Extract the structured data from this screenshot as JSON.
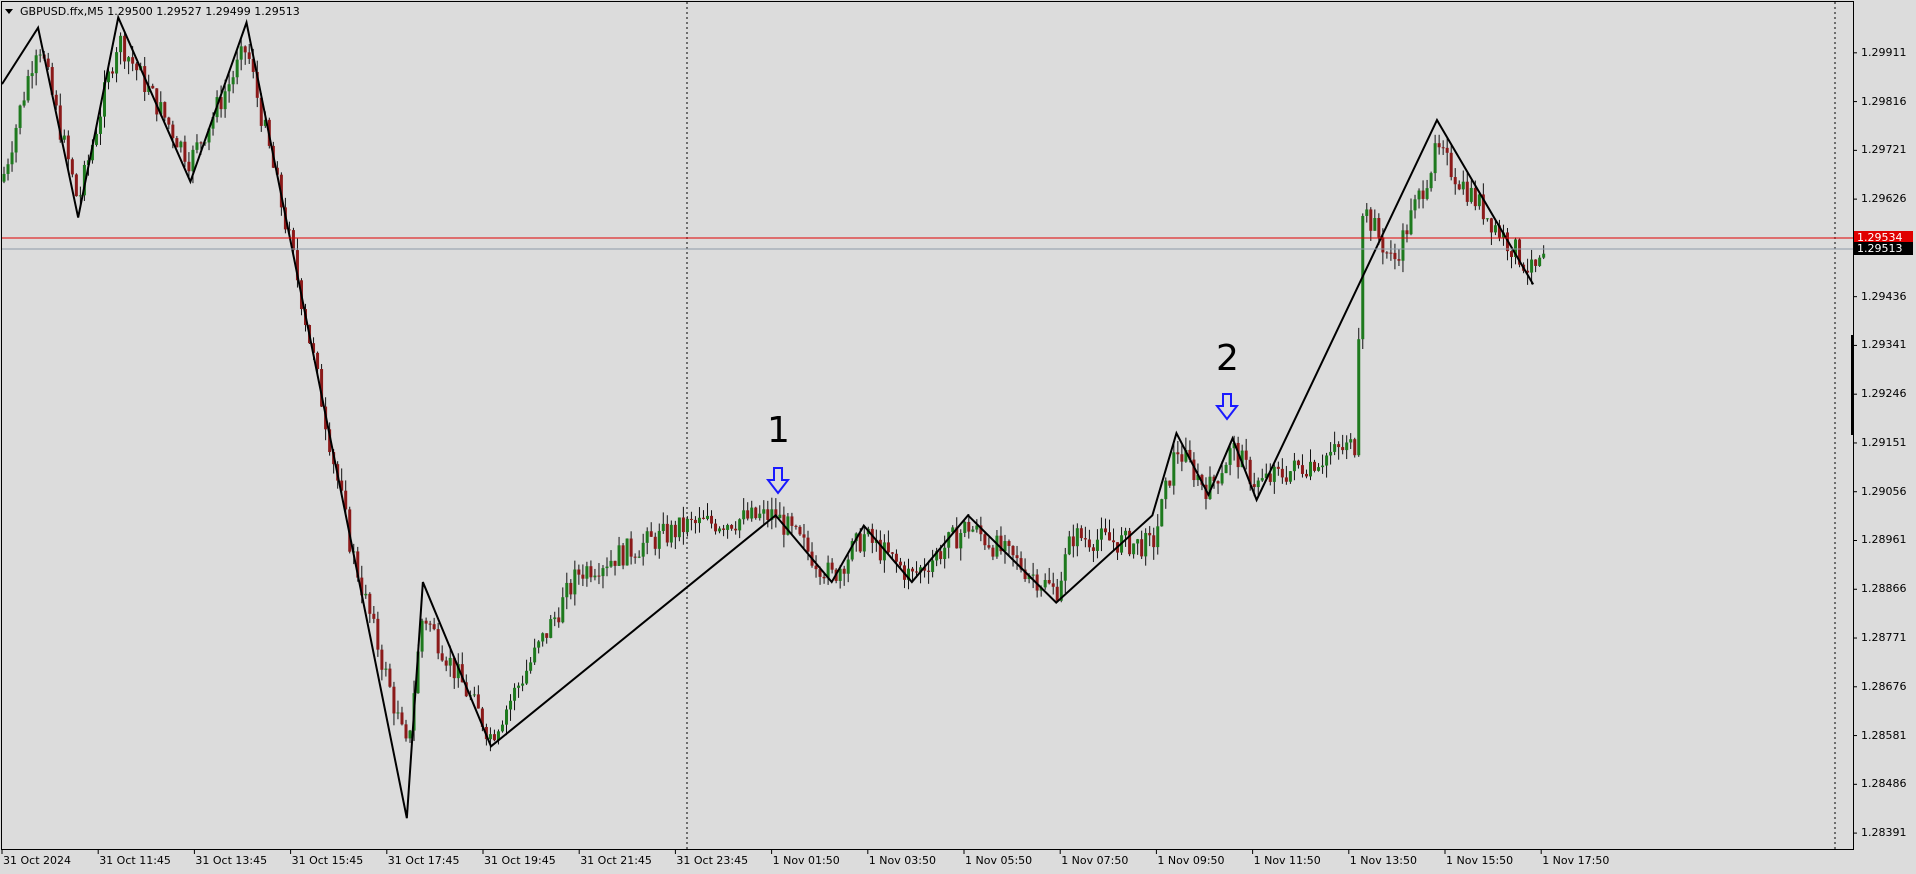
{
  "header": {
    "symbol_info": "GBPUSD.ffx,M5  1.29500 1.29527 1.29499 1.29513"
  },
  "colors": {
    "background": "#dcdcdc",
    "bull_candle": "#1e7a1e",
    "bear_candle": "#8b1a1a",
    "zigzag": "#000000",
    "bid_line": "#e00000",
    "ask_line": "#8e9aa8",
    "arrow": "#1a1aff"
  },
  "price_axis": {
    "ticks": [
      "1.29911",
      "1.29816",
      "1.29721",
      "1.29626",
      "1.29436",
      "1.29341",
      "1.29246",
      "1.29151",
      "1.29056",
      "1.28961",
      "1.28866",
      "1.28771",
      "1.28676",
      "1.28581",
      "1.28486",
      "1.28391"
    ],
    "bid_label": "1.29534",
    "ask_label": "1.29513"
  },
  "time_axis": {
    "labels": [
      "31 Oct 2024",
      "31 Oct 11:45",
      "31 Oct 13:45",
      "31 Oct 15:45",
      "31 Oct 17:45",
      "31 Oct 19:45",
      "31 Oct 21:45",
      "31 Oct 23:45",
      "1 Nov 01:50",
      "1 Nov 03:50",
      "1 Nov 05:50",
      "1 Nov 07:50",
      "1 Nov 09:50",
      "1 Nov 11:50",
      "1 Nov 13:50",
      "1 Nov 15:50",
      "1 Nov 17:50"
    ]
  },
  "annotations": [
    {
      "label": "1",
      "icon": "down-arrow-icon"
    },
    {
      "label": "2",
      "icon": "down-arrow-icon"
    }
  ],
  "chart_data": {
    "type": "candlestick",
    "timeframe": "M5",
    "ylim": [
      1.2836,
      1.3001
    ],
    "zigzag_points": [
      {
        "x": "31 Oct 2024",
        "y": 1.2985
      },
      {
        "x": "31 Oct 10:30",
        "y": 1.2996
      },
      {
        "x": "31 Oct 11:20",
        "y": 1.2959
      },
      {
        "x": "31 Oct 12:10",
        "y": 1.2998
      },
      {
        "x": "31 Oct 13:40",
        "y": 1.2966
      },
      {
        "x": "31 Oct 14:50",
        "y": 1.2997
      },
      {
        "x": "31 Oct 18:10",
        "y": 1.2842
      },
      {
        "x": "31 Oct 18:30",
        "y": 1.2888
      },
      {
        "x": "31 Oct 19:55",
        "y": 1.2856
      },
      {
        "x": "1 Nov 01:50",
        "y": 1.2901
      },
      {
        "x": "1 Nov 03:00",
        "y": 1.2888
      },
      {
        "x": "1 Nov 03:40",
        "y": 1.2899
      },
      {
        "x": "1 Nov 04:40",
        "y": 1.2888
      },
      {
        "x": "1 Nov 05:50",
        "y": 1.2901
      },
      {
        "x": "1 Nov 07:40",
        "y": 1.2884
      },
      {
        "x": "1 Nov 09:40",
        "y": 1.2901
      },
      {
        "x": "1 Nov 10:10",
        "y": 1.2917
      },
      {
        "x": "1 Nov 10:50",
        "y": 1.2905
      },
      {
        "x": "1 Nov 11:20",
        "y": 1.2916
      },
      {
        "x": "1 Nov 11:50",
        "y": 1.2904
      },
      {
        "x": "1 Nov 15:35",
        "y": 1.2978
      },
      {
        "x": "1 Nov 17:35",
        "y": 1.2946
      }
    ],
    "close_path": [
      {
        "x": "31 Oct 2024",
        "y": 1.2966
      },
      {
        "x": "31 Oct 10:30",
        "y": 1.2994
      },
      {
        "x": "31 Oct 11:20",
        "y": 1.2962
      },
      {
        "x": "31 Oct 12:10",
        "y": 1.2994
      },
      {
        "x": "31 Oct 13:40",
        "y": 1.297
      },
      {
        "x": "31 Oct 14:50",
        "y": 1.2992
      },
      {
        "x": "31 Oct 15:50",
        "y": 1.295
      },
      {
        "x": "31 Oct 17:00",
        "y": 1.2895
      },
      {
        "x": "31 Oct 18:10",
        "y": 1.2855
      },
      {
        "x": "31 Oct 18:30",
        "y": 1.2882
      },
      {
        "x": "31 Oct 19:55",
        "y": 1.2858
      },
      {
        "x": "31 Oct 21:45",
        "y": 1.289
      },
      {
        "x": "1 Nov 00:00",
        "y": 1.2899
      },
      {
        "x": "1 Nov 01:50",
        "y": 1.2901
      },
      {
        "x": "1 Nov 03:00",
        "y": 1.2889
      },
      {
        "x": "1 Nov 03:40",
        "y": 1.2897
      },
      {
        "x": "1 Nov 04:40",
        "y": 1.2889
      },
      {
        "x": "1 Nov 05:50",
        "y": 1.2899
      },
      {
        "x": "1 Nov 07:40",
        "y": 1.2886
      },
      {
        "x": "1 Nov 08:00",
        "y": 1.2897
      },
      {
        "x": "1 Nov 09:40",
        "y": 1.2895
      },
      {
        "x": "1 Nov 10:10",
        "y": 1.2914
      },
      {
        "x": "1 Nov 10:50",
        "y": 1.2906
      },
      {
        "x": "1 Nov 11:20",
        "y": 1.2914
      },
      {
        "x": "1 Nov 11:50",
        "y": 1.2907
      },
      {
        "x": "1 Nov 13:55",
        "y": 1.2915
      },
      {
        "x": "1 Nov 14:00",
        "y": 1.2962
      },
      {
        "x": "1 Nov 14:40",
        "y": 1.295
      },
      {
        "x": "1 Nov 15:35",
        "y": 1.2972
      },
      {
        "x": "1 Nov 17:35",
        "y": 1.2948
      },
      {
        "x": "1 Nov 17:50",
        "y": 1.2951
      }
    ]
  }
}
